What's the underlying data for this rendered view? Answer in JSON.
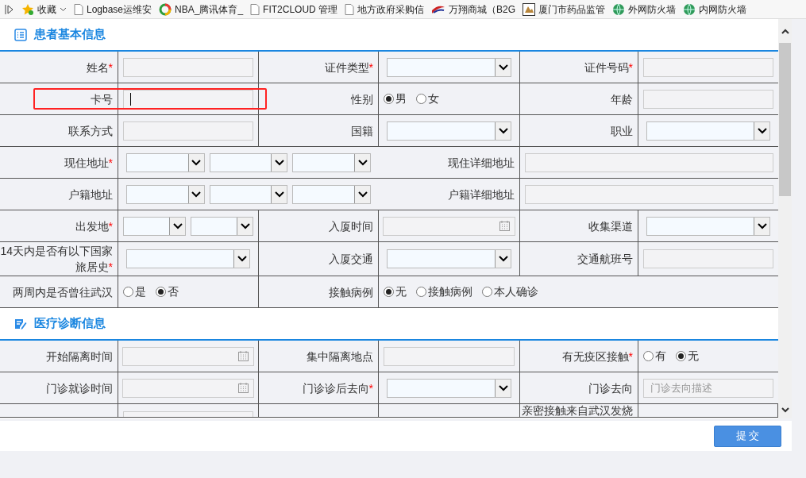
{
  "bookmarks": {
    "favorites": {
      "label": "收藏"
    },
    "items": [
      {
        "kind": "page",
        "label": "Logbase运维安"
      },
      {
        "kind": "ring",
        "label": "NBA_腾讯体育_"
      },
      {
        "kind": "page",
        "label": "FIT2CLOUD 管理"
      },
      {
        "kind": "page",
        "label": "地方政府采购信"
      },
      {
        "kind": "emblem",
        "label": "万翔商城（B2G"
      },
      {
        "kind": "square",
        "label": "厦门市药品监管"
      },
      {
        "kind": "globe",
        "label": "外网防火墙"
      },
      {
        "kind": "globe",
        "label": "内网防火墙"
      }
    ]
  },
  "sections": [
    {
      "title": "患者基本信息",
      "rows": [
        {
          "kind": "standard",
          "cells": [
            {
              "kind": "label",
              "text": "姓名",
              "required_mark": "*"
            },
            {
              "kind": "input"
            },
            {
              "kind": "label",
              "text": "证件类型",
              "required_mark": "*"
            },
            {
              "kind": "select"
            },
            {
              "kind": "label",
              "text": "证件号码",
              "required_mark": "*"
            },
            {
              "kind": "input"
            }
          ]
        },
        {
          "kind": "standard",
          "highlighted": true,
          "cells": [
            {
              "kind": "label",
              "text": "卡号"
            },
            {
              "kind": "input",
              "focused": true
            },
            {
              "kind": "label",
              "text": "性别"
            },
            {
              "kind": "radios",
              "options": [
                {
                  "label": "男",
                  "selected": true
                },
                {
                  "label": "女",
                  "selected": false
                }
              ]
            },
            {
              "kind": "label",
              "text": "年龄"
            },
            {
              "kind": "input"
            }
          ]
        },
        {
          "kind": "standard",
          "cells": [
            {
              "kind": "label",
              "text": "联系方式"
            },
            {
              "kind": "input"
            },
            {
              "kind": "label",
              "text": "国籍"
            },
            {
              "kind": "select"
            },
            {
              "kind": "label",
              "text": "职业"
            },
            {
              "kind": "select"
            }
          ]
        },
        {
          "kind": "address",
          "cells": [
            {
              "kind": "label",
              "text": "现住地址",
              "required_mark": "*"
            },
            {
              "kind": "selects"
            },
            {
              "kind": "label",
              "text": "现住详细地址"
            },
            {
              "kind": "input"
            }
          ]
        },
        {
          "kind": "address",
          "cells": [
            {
              "kind": "label",
              "text": "户籍地址"
            },
            {
              "kind": "selects"
            },
            {
              "kind": "label",
              "text": "户籍详细地址"
            },
            {
              "kind": "input"
            }
          ]
        },
        {
          "kind": "standard",
          "cells": [
            {
              "kind": "label",
              "text": "出发地",
              "required_mark": "*"
            },
            {
              "kind": "selects"
            },
            {
              "kind": "label",
              "text": "入厦时间"
            },
            {
              "kind": "date"
            },
            {
              "kind": "label",
              "text": "收集渠道"
            },
            {
              "kind": "select"
            }
          ]
        },
        {
          "kind": "standard",
          "cells": [
            {
              "kind": "label",
              "text": "14天内是否有以下国家旅居史",
              "required_mark": "*"
            },
            {
              "kind": "select"
            },
            {
              "kind": "label",
              "text": "入厦交通"
            },
            {
              "kind": "select"
            },
            {
              "kind": "label",
              "text": "交通航班号"
            },
            {
              "kind": "input"
            }
          ]
        },
        {
          "kind": "wide_radios",
          "cells": [
            {
              "kind": "label",
              "text": "两周内是否曾往武汉"
            },
            {
              "kind": "radios",
              "options": [
                {
                  "label": "是",
                  "selected": false
                },
                {
                  "label": "否",
                  "selected": true
                }
              ]
            },
            {
              "kind": "label",
              "text": "接触病例"
            },
            {
              "kind": "radios",
              "options": [
                {
                  "label": "无",
                  "selected": true
                },
                {
                  "label": "接触病例",
                  "selected": false
                },
                {
                  "label": "本人确诊",
                  "selected": false
                }
              ]
            }
          ]
        }
      ]
    },
    {
      "title": "医疗诊断信息",
      "rows": [
        {
          "kind": "standard",
          "cells": [
            {
              "kind": "label",
              "text": "开始隔离时间"
            },
            {
              "kind": "date"
            },
            {
              "kind": "label",
              "text": "集中隔离地点"
            },
            {
              "kind": "input"
            },
            {
              "kind": "label",
              "text": "有无疫区接触",
              "required_mark": "*"
            },
            {
              "kind": "radios",
              "options": [
                {
                  "label": "有",
                  "selected": false
                },
                {
                  "label": "无",
                  "selected": true
                }
              ]
            }
          ]
        },
        {
          "kind": "standard",
          "cells": [
            {
              "kind": "label",
              "text": "门诊就诊时间"
            },
            {
              "kind": "date"
            },
            {
              "kind": "label",
              "text": "门诊诊后去向",
              "required_mark": "*"
            },
            {
              "kind": "select"
            },
            {
              "kind": "label",
              "text": "门诊去向"
            },
            {
              "kind": "input",
              "placeholder": "门诊去向描述"
            }
          ]
        },
        {
          "kind": "standard",
          "cut": true,
          "cells": [
            {
              "kind": "empty"
            },
            {
              "kind": "input"
            },
            {
              "kind": "empty"
            },
            {
              "kind": "empty"
            },
            {
              "kind": "label",
              "text": "亲密接触来自武汉发烧"
            },
            {
              "kind": "empty"
            }
          ]
        }
      ]
    }
  ],
  "submit": {
    "label": "提 交"
  }
}
